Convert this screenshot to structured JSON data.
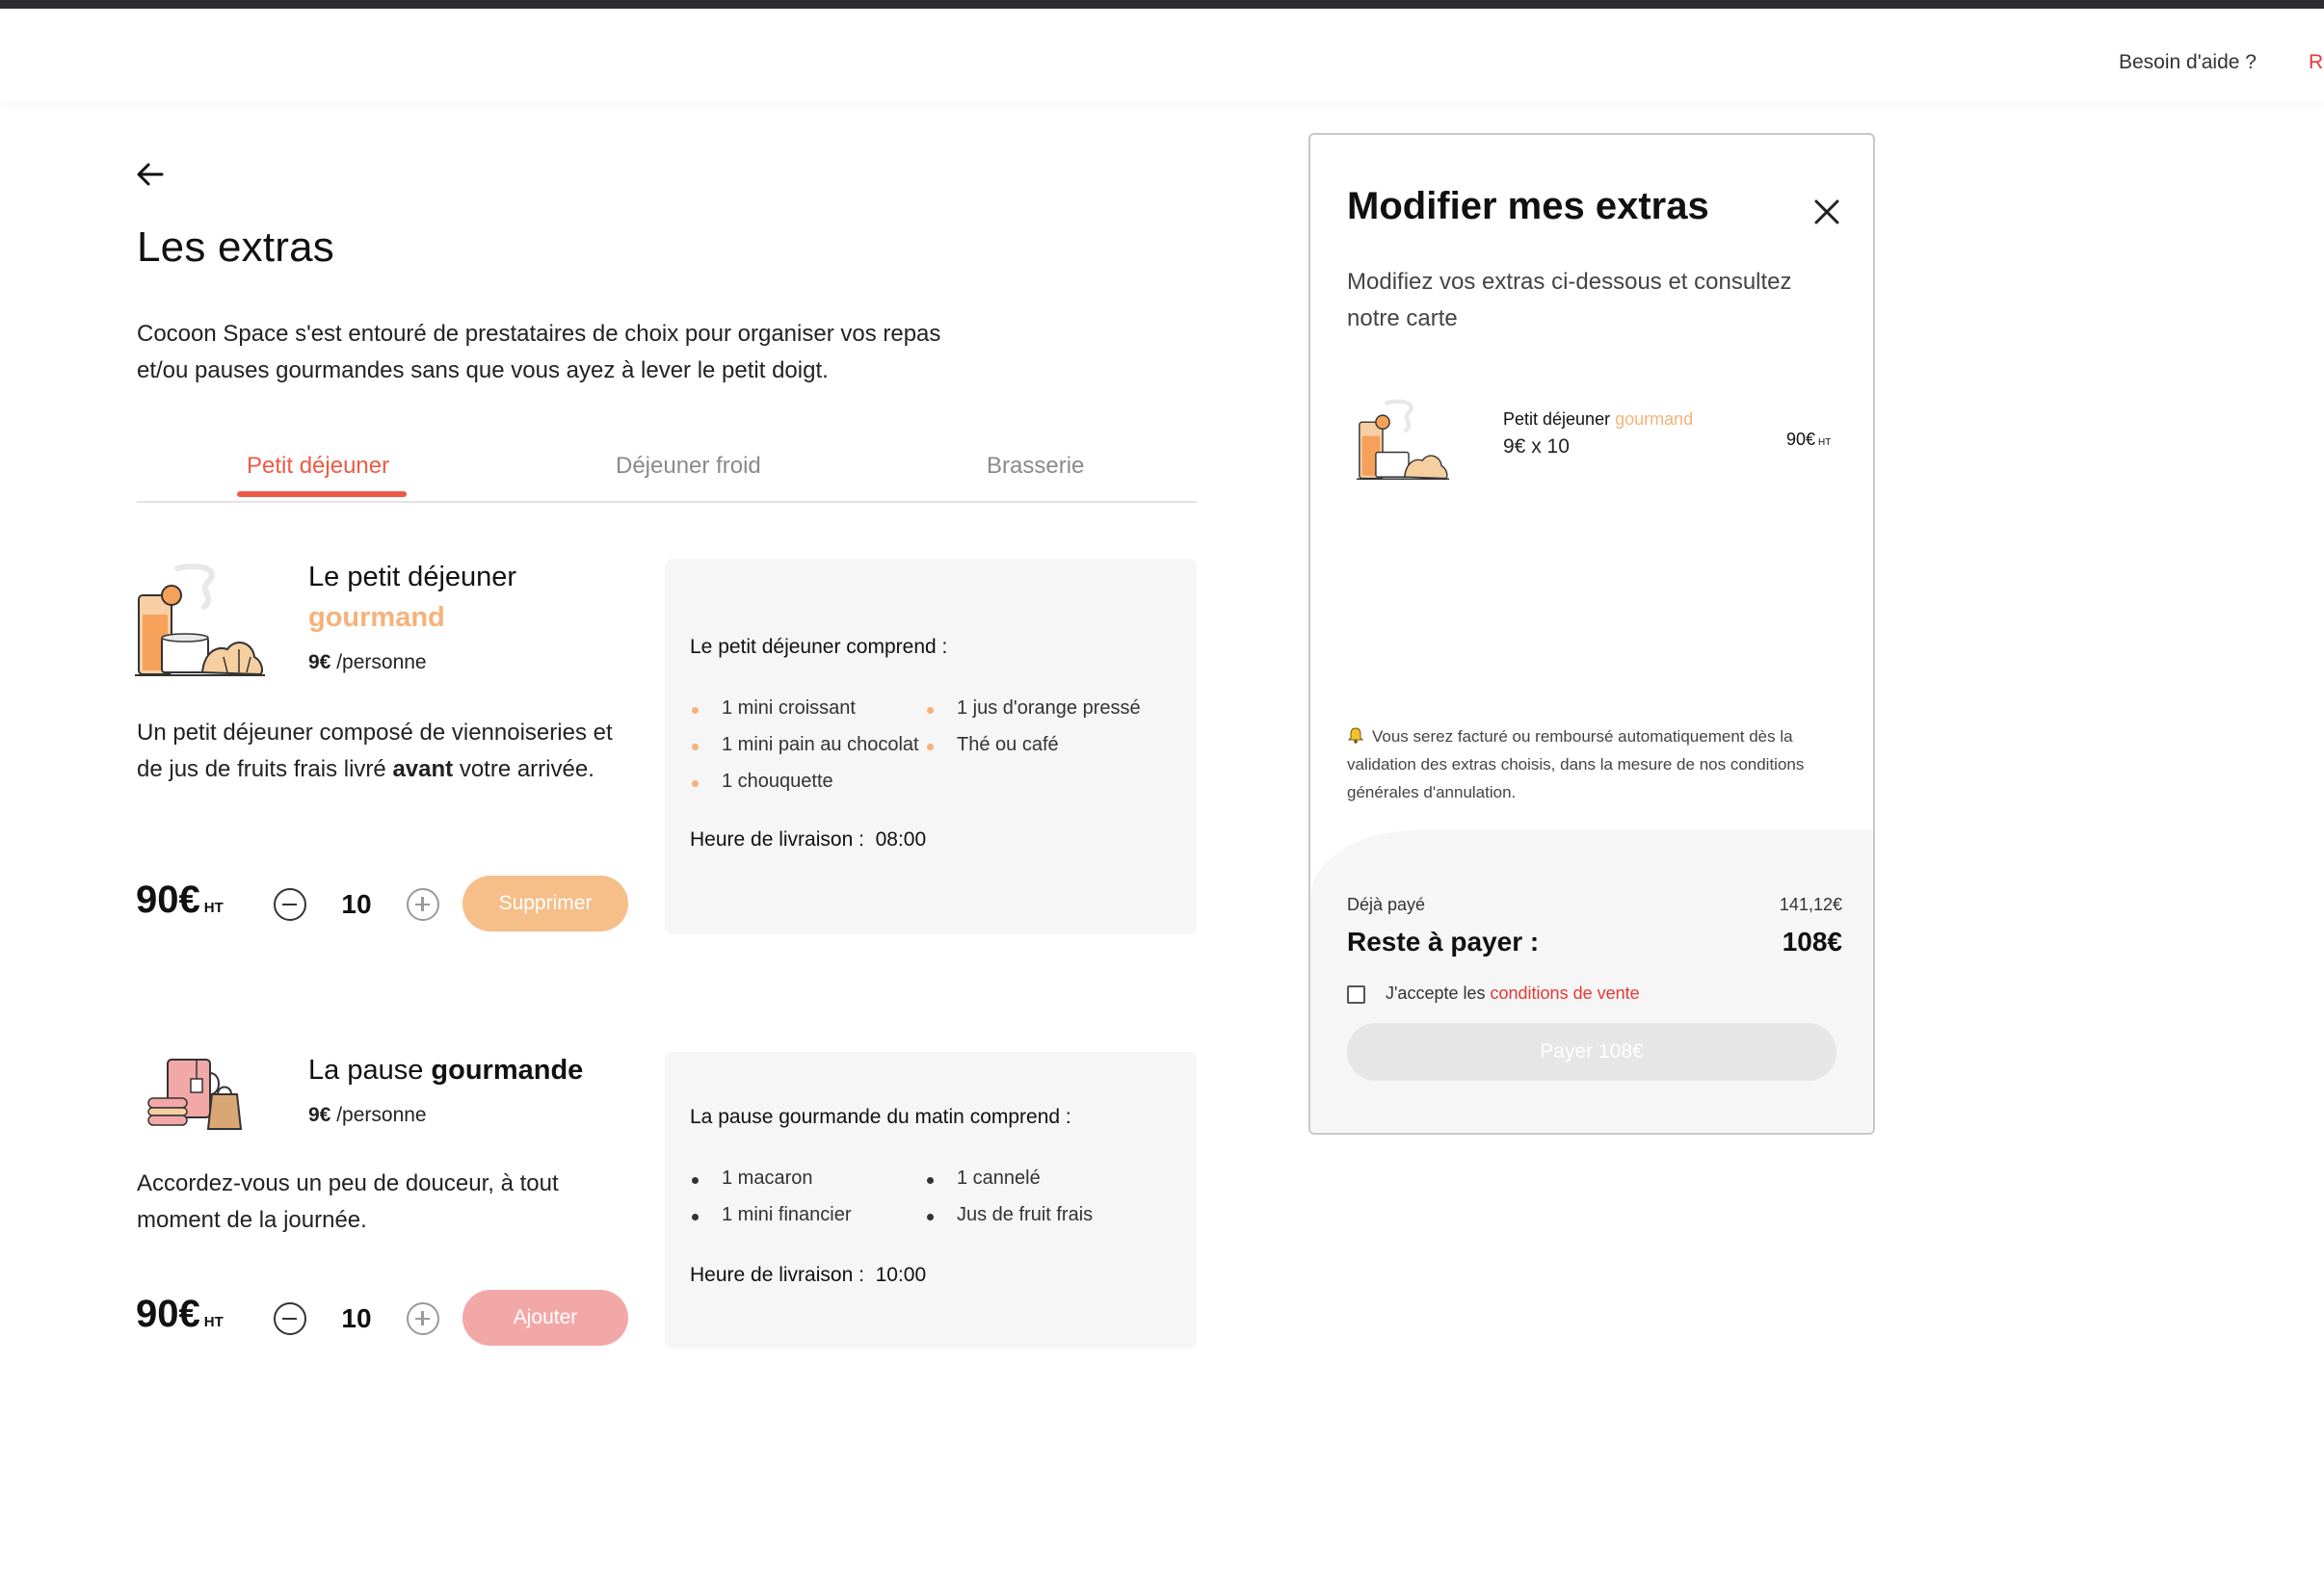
{
  "header": {
    "help_label": "Besoin d'aide ?",
    "cut_label": "R"
  },
  "page": {
    "title": "Les extras",
    "intro": "Cocoon Space s'est entouré de prestataires de choix pour organiser vos repas et/ou pauses gourmandes sans que vous ayez à lever le petit doigt."
  },
  "tabs": [
    {
      "label": "Petit déjeuner",
      "active": true
    },
    {
      "label": "Déjeuner froid",
      "active": false
    },
    {
      "label": "Brasserie",
      "active": false
    }
  ],
  "cards": [
    {
      "title_main": "Le petit déjeuner",
      "title_accent": "gourmand",
      "unit_price": "9€",
      "unit_suffix": "/personne",
      "desc_before": "Un petit déjeuner composé de viennoiseries et de jus de fruits frais livré",
      "desc_bold": "avant",
      "desc_after": "votre arrivée.",
      "total": "90€",
      "total_suffix": "HT",
      "quantity": "10",
      "action_label": "Supprimer",
      "includes_title": "Le petit déjeuner comprend :",
      "items_col1": [
        "1 mini croissant",
        "1 mini pain au chocolat",
        "1 chouquette"
      ],
      "items_col2": [
        "1 jus d'orange pressé",
        "Thé ou café"
      ],
      "delivery_label": "Heure de livraison :",
      "delivery_time": "08:00"
    },
    {
      "title_main": "La pause",
      "title_bold": "gourmande",
      "unit_price": "9€",
      "unit_suffix": "/personne",
      "desc": "Accordez-vous un peu de douceur, à tout moment de la journée.",
      "total": "90€",
      "total_suffix": "HT",
      "quantity": "10",
      "action_label": "Ajouter",
      "includes_title": "La pause gourmande du matin comprend :",
      "items_col1": [
        "1 macaron",
        "1 mini financier"
      ],
      "items_col2": [
        "1 cannelé",
        "Jus de fruit frais"
      ],
      "delivery_label": "Heure de livraison :",
      "delivery_time": "10:00"
    }
  ],
  "panel": {
    "title": "Modifier mes extras",
    "subtitle": "Modifiez vos extras ci-dessous et consultez notre carte",
    "item_name": "Petit déjeuner",
    "item_accent": "gourmand",
    "item_qty": "9€ x 10",
    "item_price": "90€",
    "item_price_suffix": "HT",
    "notice": "Vous serez facturé ou remboursé automatiquement dès la validation des extras choisis, dans la mesure de nos conditions générales d'annulation.",
    "paid_label": "Déjà payé",
    "paid_value": "141,12€",
    "rest_label": "Reste à payer :",
    "rest_value": "108€",
    "accept_prefix": "J'accepte les",
    "accept_link": "conditions de vente",
    "pay_label": "Payer 108€"
  },
  "icons": {
    "back": "arrow-left-icon",
    "close": "close-icon",
    "bell": "bell-icon",
    "minus": "minus-circle-icon",
    "plus": "plus-circle-icon"
  },
  "colors": {
    "accent_red": "#ee5a44",
    "accent_orange": "#f6b27a",
    "button_orange": "#f6be89",
    "button_pink": "#f3a8a8",
    "link_red": "#e53935"
  }
}
